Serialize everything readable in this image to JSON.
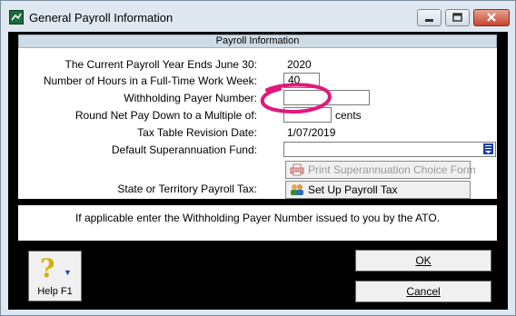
{
  "window": {
    "title": "General Payroll Information"
  },
  "panel": {
    "header": "Payroll Information",
    "year_label": "The Current Payroll Year Ends June 30:",
    "year_value": "2020",
    "hours_label": "Number of Hours in a Full-Time Work Week:",
    "hours_value": "40",
    "wpn_label": "Withholding Payer Number:",
    "wpn_value": "",
    "round_label": "Round Net Pay Down to a Multiple of:",
    "round_value": "",
    "round_unit": "cents",
    "tax_label": "Tax Table Revision Date:",
    "tax_value": "1/07/2019",
    "super_label": "Default Superannuation Fund:",
    "super_value": "",
    "print_button": "Print Superannuation Choice Form",
    "state_label": "State or Territory Payroll Tax:",
    "setup_button": "Set Up Payroll Tax"
  },
  "info_text": "If applicable enter the Withholding Payer Number issued to you by the ATO.",
  "buttons": {
    "help": "Help F1",
    "ok": "OK",
    "cancel": "Cancel"
  },
  "annotation": {
    "circle_color": "#e0197d"
  }
}
